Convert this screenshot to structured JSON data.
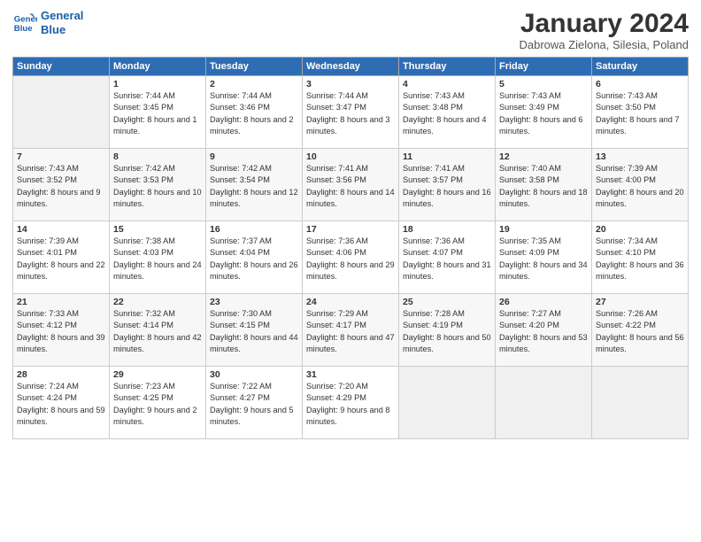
{
  "logo": {
    "line1": "General",
    "line2": "Blue"
  },
  "title": "January 2024",
  "subtitle": "Dabrowa Zielona, Silesia, Poland",
  "days_of_week": [
    "Sunday",
    "Monday",
    "Tuesday",
    "Wednesday",
    "Thursday",
    "Friday",
    "Saturday"
  ],
  "weeks": [
    [
      {
        "day": "",
        "sunrise": "",
        "sunset": "",
        "daylight": ""
      },
      {
        "day": "1",
        "sunrise": "Sunrise: 7:44 AM",
        "sunset": "Sunset: 3:45 PM",
        "daylight": "Daylight: 8 hours and 1 minute."
      },
      {
        "day": "2",
        "sunrise": "Sunrise: 7:44 AM",
        "sunset": "Sunset: 3:46 PM",
        "daylight": "Daylight: 8 hours and 2 minutes."
      },
      {
        "day": "3",
        "sunrise": "Sunrise: 7:44 AM",
        "sunset": "Sunset: 3:47 PM",
        "daylight": "Daylight: 8 hours and 3 minutes."
      },
      {
        "day": "4",
        "sunrise": "Sunrise: 7:43 AM",
        "sunset": "Sunset: 3:48 PM",
        "daylight": "Daylight: 8 hours and 4 minutes."
      },
      {
        "day": "5",
        "sunrise": "Sunrise: 7:43 AM",
        "sunset": "Sunset: 3:49 PM",
        "daylight": "Daylight: 8 hours and 6 minutes."
      },
      {
        "day": "6",
        "sunrise": "Sunrise: 7:43 AM",
        "sunset": "Sunset: 3:50 PM",
        "daylight": "Daylight: 8 hours and 7 minutes."
      }
    ],
    [
      {
        "day": "7",
        "sunrise": "Sunrise: 7:43 AM",
        "sunset": "Sunset: 3:52 PM",
        "daylight": "Daylight: 8 hours and 9 minutes."
      },
      {
        "day": "8",
        "sunrise": "Sunrise: 7:42 AM",
        "sunset": "Sunset: 3:53 PM",
        "daylight": "Daylight: 8 hours and 10 minutes."
      },
      {
        "day": "9",
        "sunrise": "Sunrise: 7:42 AM",
        "sunset": "Sunset: 3:54 PM",
        "daylight": "Daylight: 8 hours and 12 minutes."
      },
      {
        "day": "10",
        "sunrise": "Sunrise: 7:41 AM",
        "sunset": "Sunset: 3:56 PM",
        "daylight": "Daylight: 8 hours and 14 minutes."
      },
      {
        "day": "11",
        "sunrise": "Sunrise: 7:41 AM",
        "sunset": "Sunset: 3:57 PM",
        "daylight": "Daylight: 8 hours and 16 minutes."
      },
      {
        "day": "12",
        "sunrise": "Sunrise: 7:40 AM",
        "sunset": "Sunset: 3:58 PM",
        "daylight": "Daylight: 8 hours and 18 minutes."
      },
      {
        "day": "13",
        "sunrise": "Sunrise: 7:39 AM",
        "sunset": "Sunset: 4:00 PM",
        "daylight": "Daylight: 8 hours and 20 minutes."
      }
    ],
    [
      {
        "day": "14",
        "sunrise": "Sunrise: 7:39 AM",
        "sunset": "Sunset: 4:01 PM",
        "daylight": "Daylight: 8 hours and 22 minutes."
      },
      {
        "day": "15",
        "sunrise": "Sunrise: 7:38 AM",
        "sunset": "Sunset: 4:03 PM",
        "daylight": "Daylight: 8 hours and 24 minutes."
      },
      {
        "day": "16",
        "sunrise": "Sunrise: 7:37 AM",
        "sunset": "Sunset: 4:04 PM",
        "daylight": "Daylight: 8 hours and 26 minutes."
      },
      {
        "day": "17",
        "sunrise": "Sunrise: 7:36 AM",
        "sunset": "Sunset: 4:06 PM",
        "daylight": "Daylight: 8 hours and 29 minutes."
      },
      {
        "day": "18",
        "sunrise": "Sunrise: 7:36 AM",
        "sunset": "Sunset: 4:07 PM",
        "daylight": "Daylight: 8 hours and 31 minutes."
      },
      {
        "day": "19",
        "sunrise": "Sunrise: 7:35 AM",
        "sunset": "Sunset: 4:09 PM",
        "daylight": "Daylight: 8 hours and 34 minutes."
      },
      {
        "day": "20",
        "sunrise": "Sunrise: 7:34 AM",
        "sunset": "Sunset: 4:10 PM",
        "daylight": "Daylight: 8 hours and 36 minutes."
      }
    ],
    [
      {
        "day": "21",
        "sunrise": "Sunrise: 7:33 AM",
        "sunset": "Sunset: 4:12 PM",
        "daylight": "Daylight: 8 hours and 39 minutes."
      },
      {
        "day": "22",
        "sunrise": "Sunrise: 7:32 AM",
        "sunset": "Sunset: 4:14 PM",
        "daylight": "Daylight: 8 hours and 42 minutes."
      },
      {
        "day": "23",
        "sunrise": "Sunrise: 7:30 AM",
        "sunset": "Sunset: 4:15 PM",
        "daylight": "Daylight: 8 hours and 44 minutes."
      },
      {
        "day": "24",
        "sunrise": "Sunrise: 7:29 AM",
        "sunset": "Sunset: 4:17 PM",
        "daylight": "Daylight: 8 hours and 47 minutes."
      },
      {
        "day": "25",
        "sunrise": "Sunrise: 7:28 AM",
        "sunset": "Sunset: 4:19 PM",
        "daylight": "Daylight: 8 hours and 50 minutes."
      },
      {
        "day": "26",
        "sunrise": "Sunrise: 7:27 AM",
        "sunset": "Sunset: 4:20 PM",
        "daylight": "Daylight: 8 hours and 53 minutes."
      },
      {
        "day": "27",
        "sunrise": "Sunrise: 7:26 AM",
        "sunset": "Sunset: 4:22 PM",
        "daylight": "Daylight: 8 hours and 56 minutes."
      }
    ],
    [
      {
        "day": "28",
        "sunrise": "Sunrise: 7:24 AM",
        "sunset": "Sunset: 4:24 PM",
        "daylight": "Daylight: 8 hours and 59 minutes."
      },
      {
        "day": "29",
        "sunrise": "Sunrise: 7:23 AM",
        "sunset": "Sunset: 4:25 PM",
        "daylight": "Daylight: 9 hours and 2 minutes."
      },
      {
        "day": "30",
        "sunrise": "Sunrise: 7:22 AM",
        "sunset": "Sunset: 4:27 PM",
        "daylight": "Daylight: 9 hours and 5 minutes."
      },
      {
        "day": "31",
        "sunrise": "Sunrise: 7:20 AM",
        "sunset": "Sunset: 4:29 PM",
        "daylight": "Daylight: 9 hours and 8 minutes."
      },
      {
        "day": "",
        "sunrise": "",
        "sunset": "",
        "daylight": ""
      },
      {
        "day": "",
        "sunrise": "",
        "sunset": "",
        "daylight": ""
      },
      {
        "day": "",
        "sunrise": "",
        "sunset": "",
        "daylight": ""
      }
    ]
  ]
}
